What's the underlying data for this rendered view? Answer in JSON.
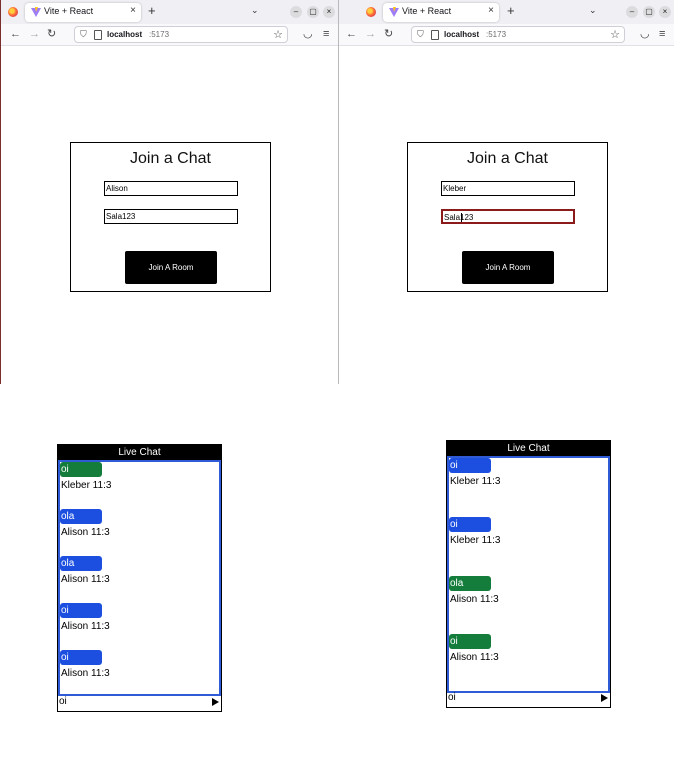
{
  "browser": {
    "tab_title": "Vite + React",
    "close_glyph": "×",
    "new_tab_glyph": "+",
    "tab_list_glyph": "⌄",
    "url_host": "localhost",
    "url_port": ":5173",
    "minimize_glyph": "–",
    "maximize_glyph": "▢",
    "window_close_glyph": "×",
    "back_glyph": "←",
    "forward_glyph": "→",
    "reload_glyph": "↻",
    "shield_glyph": "⛉",
    "star_glyph": "☆",
    "pocket_glyph": "◡",
    "menu_glyph": "≡"
  },
  "left_window": {
    "join": {
      "title": "Join a Chat",
      "name_value": "Alison",
      "room_value": "Sala123",
      "button_label": "Join A Room"
    }
  },
  "right_window": {
    "join": {
      "title": "Join a Chat",
      "name_value": "Kleber",
      "room_value": "Sala123",
      "button_label": "Join A Room"
    }
  },
  "left_chat": {
    "header": "Live Chat",
    "messages": [
      {
        "text": "oi",
        "meta": "Kleber 11:3",
        "color": "#147d3c"
      },
      {
        "text": "ola",
        "meta": "Alison 11:3",
        "color": "#1c4fe0"
      },
      {
        "text": "ola",
        "meta": "Alison 11:3",
        "color": "#1c4fe0"
      },
      {
        "text": "oi",
        "meta": "Alison 11:3",
        "color": "#1c4fe0"
      },
      {
        "text": "oi",
        "meta": "Alison 11:3",
        "color": "#1c4fe0"
      }
    ],
    "input_value": "oi",
    "send_icon": "send-icon"
  },
  "right_chat": {
    "header": "Live Chat",
    "messages": [
      {
        "text": "oi",
        "meta": "Kleber 11:3",
        "color": "#1c4fe0"
      },
      {
        "text": "oi",
        "meta": "Kleber 11:3",
        "color": "#1c4fe0"
      },
      {
        "text": "ola",
        "meta": "Alison 11:3",
        "color": "#147d3c"
      },
      {
        "text": "oi",
        "meta": "Alison 11:3",
        "color": "#147d3c"
      }
    ],
    "input_value": "oi",
    "send_icon": "send-icon"
  },
  "colors": {
    "focus_border": "#8b1a1a",
    "chat_border": "#2f5bd6",
    "bubble_blue": "#1c4fe0",
    "bubble_green": "#147d3c"
  }
}
